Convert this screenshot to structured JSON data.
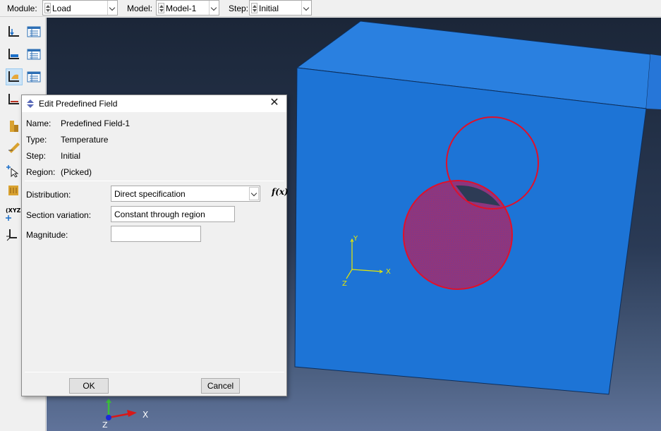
{
  "toolbar": {
    "module_label": "Module:",
    "module_value": "Load",
    "model_label": "Model:",
    "model_value": "Model-1",
    "step_label": "Step:",
    "step_value": "Initial"
  },
  "dialog": {
    "title": "Edit Predefined Field",
    "close_glyph": "✕",
    "name_label": "Name:",
    "name_value": "Predefined Field-1",
    "type_label": "Type:",
    "type_value": "Temperature",
    "step_label": "Step:",
    "step_value": "Initial",
    "region_label": "Region:",
    "region_value": "(Picked)",
    "distribution_label": "Distribution:",
    "distribution_value": "Direct specification",
    "fx_label": "f(x)",
    "section_variation_label": "Section variation:",
    "section_variation_value": "Constant through region",
    "magnitude_label": "Magnitude:",
    "magnitude_value": "",
    "ok_label": "OK",
    "cancel_label": "Cancel"
  },
  "viewport": {
    "triad_local": {
      "y": "Y",
      "x": "X",
      "z": "Z"
    },
    "triad_global": {
      "x": "X",
      "z": "Z"
    }
  },
  "colors": {
    "part_front": "#1d74d6",
    "part_top": "#2a80e0",
    "selection_edge": "#e0102a",
    "selection_fill": "#a0306e",
    "triad_local": "#e8e800"
  }
}
